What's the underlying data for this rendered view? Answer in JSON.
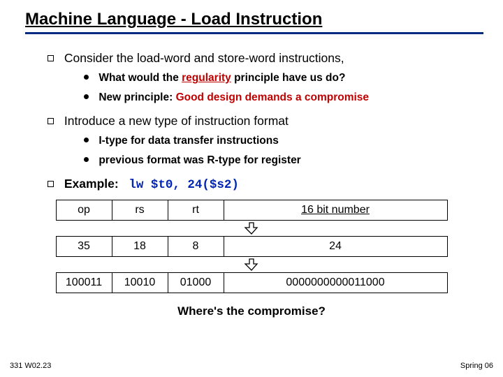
{
  "title": "Machine Language - Load Instruction",
  "b1": "Consider the load-word and store-word instructions,",
  "b1a_pre": "What would the ",
  "b1a_red": "regularity",
  "b1a_post": " principle have us do?",
  "b1b_pre": "New principle:  ",
  "b1b_red": "Good design demands a compromise",
  "b2": "Introduce a new type of instruction format",
  "b2a": "I-type for data transfer instructions",
  "b2b": "previous format was R-type for register",
  "b3_label": "Example:",
  "b3_code": "lw $t0, 24($s2)",
  "hdr_op": "op",
  "hdr_rs": "rs",
  "hdr_rt": "rt",
  "hdr_num": "16 bit number",
  "r1_op": "35",
  "r1_rs": "18",
  "r1_rt": "8",
  "r1_num": "24",
  "r2_op": "100011",
  "r2_rs": "10010",
  "r2_rt": "01000",
  "r2_num": "0000000000011000",
  "footer_q": "Where's the compromise?",
  "footer_left": "331 W02.23",
  "footer_right": "Spring 06"
}
